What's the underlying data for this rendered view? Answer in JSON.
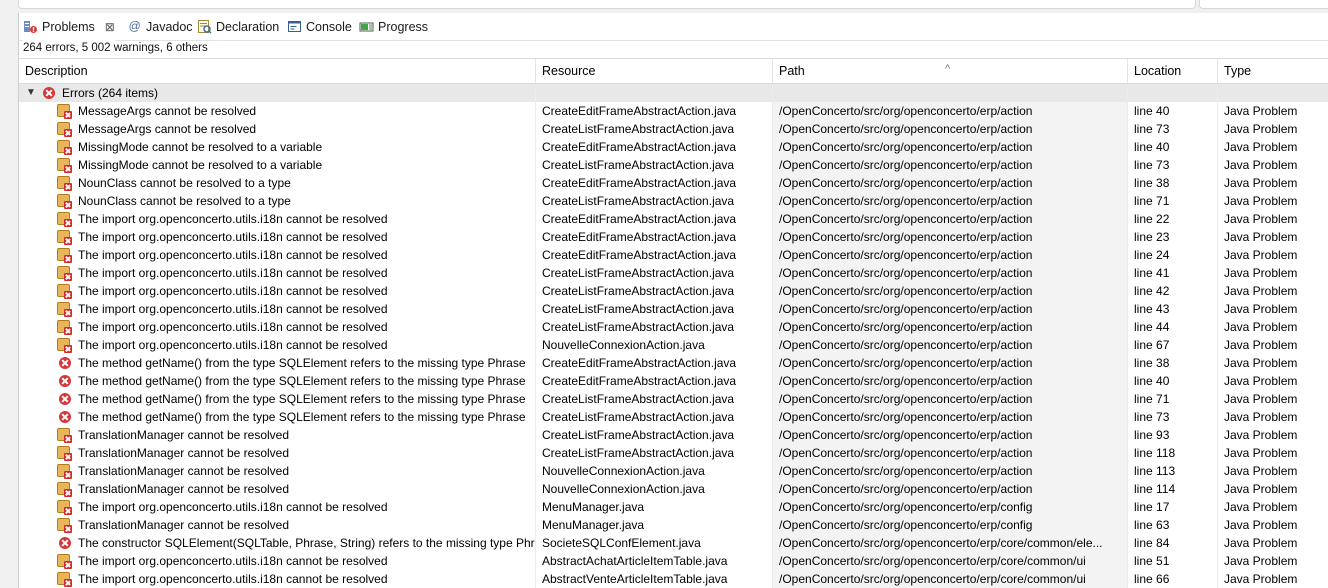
{
  "tabs": [
    {
      "label": "Problems",
      "icon": "problems-icon",
      "active": true,
      "closable": true
    },
    {
      "label": "Javadoc",
      "icon": "at-sign-icon"
    },
    {
      "label": "Declaration",
      "icon": "declaration-icon"
    },
    {
      "label": "Console",
      "icon": "console-icon"
    },
    {
      "label": "Progress",
      "icon": "progress-icon"
    }
  ],
  "summary": "264 errors, 5 002 warnings, 6 others",
  "columns": {
    "description": "Description",
    "resource": "Resource",
    "path": "Path",
    "location": "Location",
    "type": "Type"
  },
  "sort_indicator": "^",
  "group": {
    "label": "Errors (264 items)",
    "expanded": true,
    "icon": "error-icon"
  },
  "rows": [
    {
      "icon": "java-error-icon",
      "description": "MessageArgs cannot be resolved",
      "resource": "CreateEditFrameAbstractAction.java",
      "path": "/OpenConcerto/src/org/openconcerto/erp/action",
      "location": "line 40",
      "type": "Java Problem"
    },
    {
      "icon": "java-error-icon",
      "description": "MessageArgs cannot be resolved",
      "resource": "CreateListFrameAbstractAction.java",
      "path": "/OpenConcerto/src/org/openconcerto/erp/action",
      "location": "line 73",
      "type": "Java Problem"
    },
    {
      "icon": "java-error-icon",
      "description": "MissingMode cannot be resolved to a variable",
      "resource": "CreateEditFrameAbstractAction.java",
      "path": "/OpenConcerto/src/org/openconcerto/erp/action",
      "location": "line 40",
      "type": "Java Problem"
    },
    {
      "icon": "java-error-icon",
      "description": "MissingMode cannot be resolved to a variable",
      "resource": "CreateListFrameAbstractAction.java",
      "path": "/OpenConcerto/src/org/openconcerto/erp/action",
      "location": "line 73",
      "type": "Java Problem"
    },
    {
      "icon": "java-error-icon",
      "description": "NounClass cannot be resolved to a type",
      "resource": "CreateEditFrameAbstractAction.java",
      "path": "/OpenConcerto/src/org/openconcerto/erp/action",
      "location": "line 38",
      "type": "Java Problem"
    },
    {
      "icon": "java-error-icon",
      "description": "NounClass cannot be resolved to a type",
      "resource": "CreateListFrameAbstractAction.java",
      "path": "/OpenConcerto/src/org/openconcerto/erp/action",
      "location": "line 71",
      "type": "Java Problem"
    },
    {
      "icon": "java-error-icon",
      "description": "The import org.openconcerto.utils.i18n cannot be resolved",
      "resource": "CreateEditFrameAbstractAction.java",
      "path": "/OpenConcerto/src/org/openconcerto/erp/action",
      "location": "line 22",
      "type": "Java Problem"
    },
    {
      "icon": "java-error-icon",
      "description": "The import org.openconcerto.utils.i18n cannot be resolved",
      "resource": "CreateEditFrameAbstractAction.java",
      "path": "/OpenConcerto/src/org/openconcerto/erp/action",
      "location": "line 23",
      "type": "Java Problem"
    },
    {
      "icon": "java-error-icon",
      "description": "The import org.openconcerto.utils.i18n cannot be resolved",
      "resource": "CreateEditFrameAbstractAction.java",
      "path": "/OpenConcerto/src/org/openconcerto/erp/action",
      "location": "line 24",
      "type": "Java Problem"
    },
    {
      "icon": "java-error-icon",
      "description": "The import org.openconcerto.utils.i18n cannot be resolved",
      "resource": "CreateListFrameAbstractAction.java",
      "path": "/OpenConcerto/src/org/openconcerto/erp/action",
      "location": "line 41",
      "type": "Java Problem"
    },
    {
      "icon": "java-error-icon",
      "description": "The import org.openconcerto.utils.i18n cannot be resolved",
      "resource": "CreateListFrameAbstractAction.java",
      "path": "/OpenConcerto/src/org/openconcerto/erp/action",
      "location": "line 42",
      "type": "Java Problem"
    },
    {
      "icon": "java-error-icon",
      "description": "The import org.openconcerto.utils.i18n cannot be resolved",
      "resource": "CreateListFrameAbstractAction.java",
      "path": "/OpenConcerto/src/org/openconcerto/erp/action",
      "location": "line 43",
      "type": "Java Problem"
    },
    {
      "icon": "java-error-icon",
      "description": "The import org.openconcerto.utils.i18n cannot be resolved",
      "resource": "CreateListFrameAbstractAction.java",
      "path": "/OpenConcerto/src/org/openconcerto/erp/action",
      "location": "line 44",
      "type": "Java Problem"
    },
    {
      "icon": "java-error-icon",
      "description": "The import org.openconcerto.utils.i18n cannot be resolved",
      "resource": "NouvelleConnexionAction.java",
      "path": "/OpenConcerto/src/org/openconcerto/erp/action",
      "location": "line 67",
      "type": "Java Problem"
    },
    {
      "icon": "error-icon",
      "description": "The method getName() from the type SQLElement refers to the missing type Phrase",
      "resource": "CreateEditFrameAbstractAction.java",
      "path": "/OpenConcerto/src/org/openconcerto/erp/action",
      "location": "line 38",
      "type": "Java Problem"
    },
    {
      "icon": "error-icon",
      "description": "The method getName() from the type SQLElement refers to the missing type Phrase",
      "resource": "CreateEditFrameAbstractAction.java",
      "path": "/OpenConcerto/src/org/openconcerto/erp/action",
      "location": "line 40",
      "type": "Java Problem"
    },
    {
      "icon": "error-icon",
      "description": "The method getName() from the type SQLElement refers to the missing type Phrase",
      "resource": "CreateListFrameAbstractAction.java",
      "path": "/OpenConcerto/src/org/openconcerto/erp/action",
      "location": "line 71",
      "type": "Java Problem"
    },
    {
      "icon": "error-icon",
      "description": "The method getName() from the type SQLElement refers to the missing type Phrase",
      "resource": "CreateListFrameAbstractAction.java",
      "path": "/OpenConcerto/src/org/openconcerto/erp/action",
      "location": "line 73",
      "type": "Java Problem"
    },
    {
      "icon": "java-error-icon",
      "description": "TranslationManager cannot be resolved",
      "resource": "CreateListFrameAbstractAction.java",
      "path": "/OpenConcerto/src/org/openconcerto/erp/action",
      "location": "line 93",
      "type": "Java Problem"
    },
    {
      "icon": "java-error-icon",
      "description": "TranslationManager cannot be resolved",
      "resource": "CreateListFrameAbstractAction.java",
      "path": "/OpenConcerto/src/org/openconcerto/erp/action",
      "location": "line 118",
      "type": "Java Problem"
    },
    {
      "icon": "java-error-icon",
      "description": "TranslationManager cannot be resolved",
      "resource": "NouvelleConnexionAction.java",
      "path": "/OpenConcerto/src/org/openconcerto/erp/action",
      "location": "line 113",
      "type": "Java Problem"
    },
    {
      "icon": "java-error-icon",
      "description": "TranslationManager cannot be resolved",
      "resource": "NouvelleConnexionAction.java",
      "path": "/OpenConcerto/src/org/openconcerto/erp/action",
      "location": "line 114",
      "type": "Java Problem"
    },
    {
      "icon": "java-error-icon",
      "description": "The import org.openconcerto.utils.i18n cannot be resolved",
      "resource": "MenuManager.java",
      "path": "/OpenConcerto/src/org/openconcerto/erp/config",
      "location": "line 17",
      "type": "Java Problem"
    },
    {
      "icon": "java-error-icon",
      "description": "TranslationManager cannot be resolved",
      "resource": "MenuManager.java",
      "path": "/OpenConcerto/src/org/openconcerto/erp/config",
      "location": "line 63",
      "type": "Java Problem"
    },
    {
      "icon": "error-icon",
      "description": "The constructor SQLElement(SQLTable, Phrase, String) refers to the missing type Phrase",
      "resource": "SocieteSQLConfElement.java",
      "path": "/OpenConcerto/src/org/openconcerto/erp/core/common/ele...",
      "location": "line 84",
      "type": "Java Problem"
    },
    {
      "icon": "java-error-icon",
      "description": "The import org.openconcerto.utils.i18n cannot be resolved",
      "resource": "AbstractAchatArticleItemTable.java",
      "path": "/OpenConcerto/src/org/openconcerto/erp/core/common/ui",
      "location": "line 51",
      "type": "Java Problem"
    },
    {
      "icon": "java-error-icon",
      "description": "The import org.openconcerto.utils.i18n cannot be resolved",
      "resource": "AbstractVenteArticleItemTable.java",
      "path": "/OpenConcerto/src/org/openconcerto/erp/core/common/ui",
      "location": "line 66",
      "type": "Java Problem"
    }
  ]
}
